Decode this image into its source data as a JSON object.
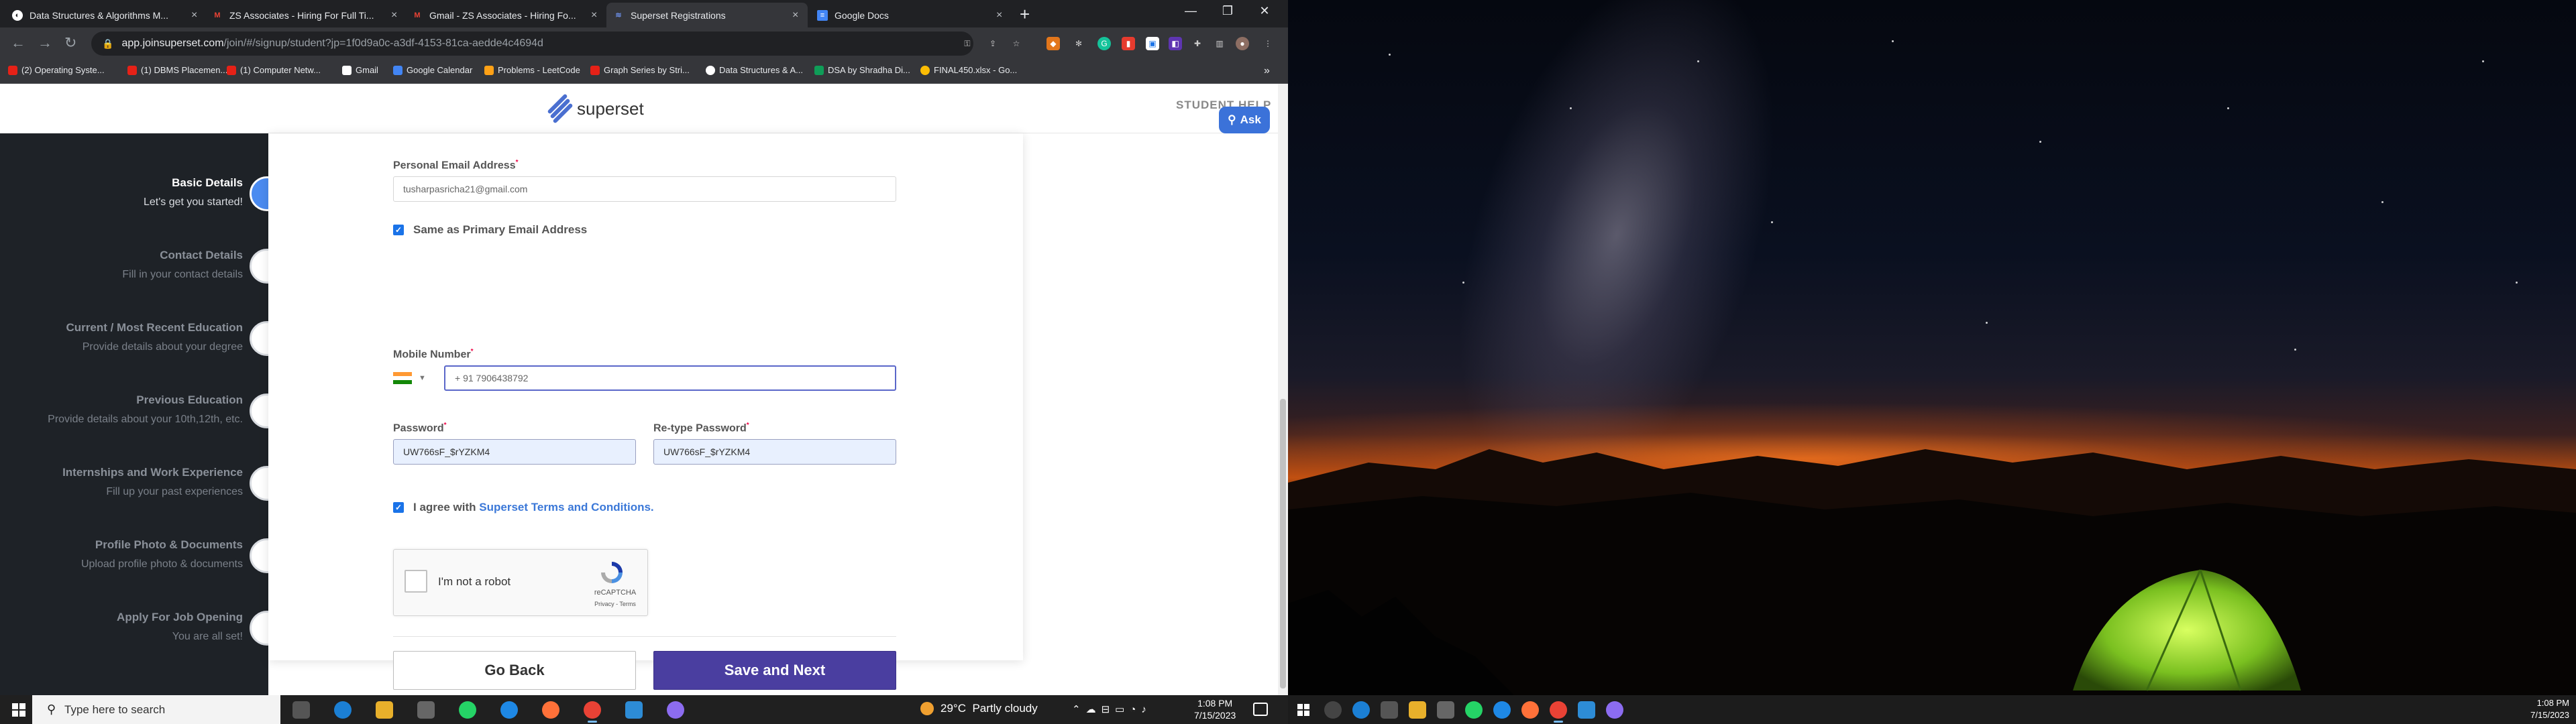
{
  "browser": {
    "tabs": [
      {
        "label": "Data Structures & Algorithms M...",
        "favicon": "leetcode-icon"
      },
      {
        "label": "ZS Associates - Hiring For Full Ti...",
        "favicon": "gmail-icon"
      },
      {
        "label": "Gmail - ZS Associates - Hiring Fo...",
        "favicon": "gmail-icon"
      },
      {
        "label": "Superset Registrations",
        "favicon": "superset-icon"
      },
      {
        "label": "Google Docs",
        "favicon": "docs-icon"
      }
    ],
    "new_tab_label": "+",
    "url_host": "app.joinsuperset.com",
    "url_path": "/join/#/signup/student?jp=1f0d9a0c-a3df-4153-81ca-aedde4c4694d",
    "bookmarks": [
      "(2) Operating Syste...",
      "(1) DBMS Placemen...",
      "(1) Computer Netw...",
      "Gmail",
      "Google Calendar",
      "Problems - LeetCode",
      "Graph Series by Stri...",
      "Data Structures & A...",
      "DSA by Shradha Di...",
      "FINAL450.xlsx - Go..."
    ],
    "bookmarks_more": "»"
  },
  "header": {
    "brand": "superset",
    "help_text": "STUDENT HELP",
    "ask_label": "Ask"
  },
  "steps": [
    {
      "title": "Basic Details",
      "subtitle": "Let's get you started!",
      "active": true
    },
    {
      "title": "Contact Details",
      "subtitle": "Fill in your contact details",
      "active": false
    },
    {
      "title": "Current / Most Recent Education",
      "subtitle": "Provide details about your degree",
      "active": false
    },
    {
      "title": "Previous Education",
      "subtitle": "Provide details about your 10th,12th, etc.",
      "active": false
    },
    {
      "title": "Internships and Work Experience",
      "subtitle": "Fill up your past experiences",
      "active": false
    },
    {
      "title": "Profile Photo & Documents",
      "subtitle": "Upload profile photo & documents",
      "active": false
    },
    {
      "title": "Apply For Job Opening",
      "subtitle": "You are all set!",
      "active": false
    }
  ],
  "form": {
    "personal_email_label": "Personal Email Address",
    "personal_email_value": "tusharpasricha21@gmail.com",
    "same_as_primary_label": "Same as Primary Email Address",
    "same_as_primary_checked": true,
    "mobile_label": "Mobile Number",
    "mobile_value": "+ 91  7906438792",
    "password_label": "Password",
    "password_value": "UW766sF_$rYZKM4",
    "retype_password_label": "Re-type Password",
    "retype_password_value": "UW766sF_$rYZKM4",
    "agree_prefix": "I agree with",
    "terms_link": "Superset Terms and Conditions.",
    "agree_checked": true,
    "required_mark": "*",
    "captcha_label": "I'm not a robot",
    "captcha_brand": "reCAPTCHA",
    "captcha_links": "Privacy - Terms",
    "go_back_label": "Go Back",
    "save_next_label": "Save and Next"
  },
  "taskbar": {
    "search_placeholder": "Type here to search",
    "weather_temp": "29°C",
    "weather_desc": "Partly cloudy",
    "time": "1:08 PM",
    "date": "7/15/2023"
  },
  "right_taskbar": {
    "time": "1:08 PM",
    "date": "7/15/2023"
  },
  "colors": {
    "accent": "#4a3ea0",
    "link": "#3b78d8",
    "sidebar_bg": "#1e2227",
    "active_dot": "#4b8bf0"
  }
}
